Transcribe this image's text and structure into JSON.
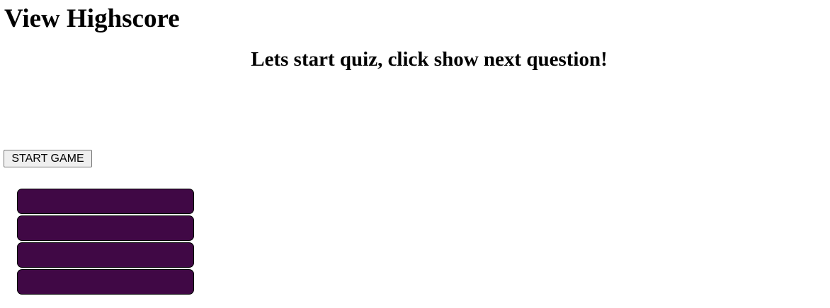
{
  "header": {
    "highscore_link": "View Highscore"
  },
  "quiz": {
    "prompt": "Lets start quiz, click show next question!",
    "start_button": "START GAME",
    "answers": [
      {
        "label": ""
      },
      {
        "label": ""
      },
      {
        "label": ""
      },
      {
        "label": ""
      }
    ]
  },
  "colors": {
    "answer_button_background": "#400845",
    "answer_button_border": "#000000",
    "page_background": "#ffffff"
  }
}
